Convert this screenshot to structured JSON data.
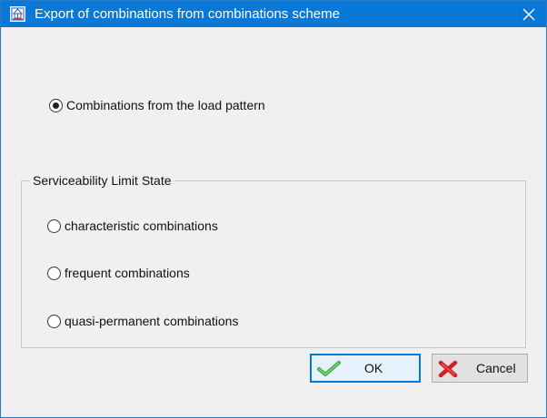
{
  "window": {
    "title": "Export of combinations from combinations scheme",
    "title_bar_color": "#0a78d7"
  },
  "source": {
    "option_label": "Combinations from the load pattern",
    "selected": true
  },
  "sls_group": {
    "title": "Serviceability Limit State",
    "options": [
      {
        "label": "characteristic combinations",
        "selected": false
      },
      {
        "label": "frequent combinations",
        "selected": false
      },
      {
        "label": "quasi-permanent combinations",
        "selected": false
      }
    ]
  },
  "buttons": {
    "ok_label": "OK",
    "ok_icon": "green-checkmark-icon",
    "cancel_label": "Cancel",
    "cancel_icon": "red-x-icon"
  },
  "icons": {
    "app": "app-structure-icon",
    "close": "close-icon"
  }
}
